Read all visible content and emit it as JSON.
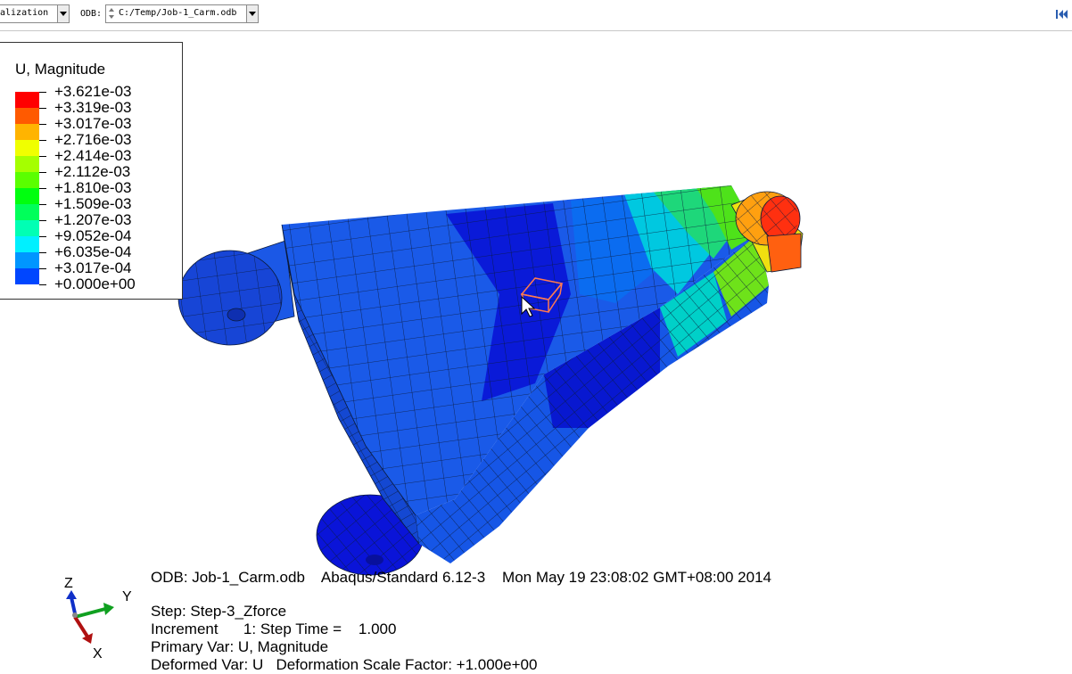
{
  "toolbar": {
    "visualization_combo": "alization",
    "odb_label": "ODB:",
    "odb_path": "C:/Temp/Job-1_Carm.odb"
  },
  "legend": {
    "title": "U, Magnitude",
    "entries": [
      {
        "value": "+3.621e-03",
        "color": "#ff0000"
      },
      {
        "value": "+3.319e-03",
        "color": "#ff5a00"
      },
      {
        "value": "+3.017e-03",
        "color": "#ffb400"
      },
      {
        "value": "+2.716e-03",
        "color": "#f0ff00"
      },
      {
        "value": "+2.414e-03",
        "color": "#a5ff00"
      },
      {
        "value": "+2.112e-03",
        "color": "#5aff00"
      },
      {
        "value": "+1.810e-03",
        "color": "#00ff0f"
      },
      {
        "value": "+1.509e-03",
        "color": "#00ff5a"
      },
      {
        "value": "+1.207e-03",
        "color": "#00ffb4"
      },
      {
        "value": "+9.052e-04",
        "color": "#00f0ff"
      },
      {
        "value": "+6.035e-04",
        "color": "#0096ff"
      },
      {
        "value": "+3.017e-04",
        "color": "#0046ff"
      }
    ],
    "last_value": "+0.000e+00"
  },
  "info": {
    "odb_line": "ODB: Job-1_Carm.odb    Abaqus/Standard 6.12-3    Mon May 19 23:08:02 GMT+08:00 2014",
    "step_line": "Step: Step-3_Zforce",
    "increment_line": "Increment      1: Step Time =    1.000",
    "primary_line": "Primary Var: U, Magnitude",
    "deformed_line": "Deformed Var: U   Deformation Scale Factor: +1.000e+00"
  },
  "triad": {
    "z": "Z",
    "y": "Y",
    "x": "X"
  }
}
